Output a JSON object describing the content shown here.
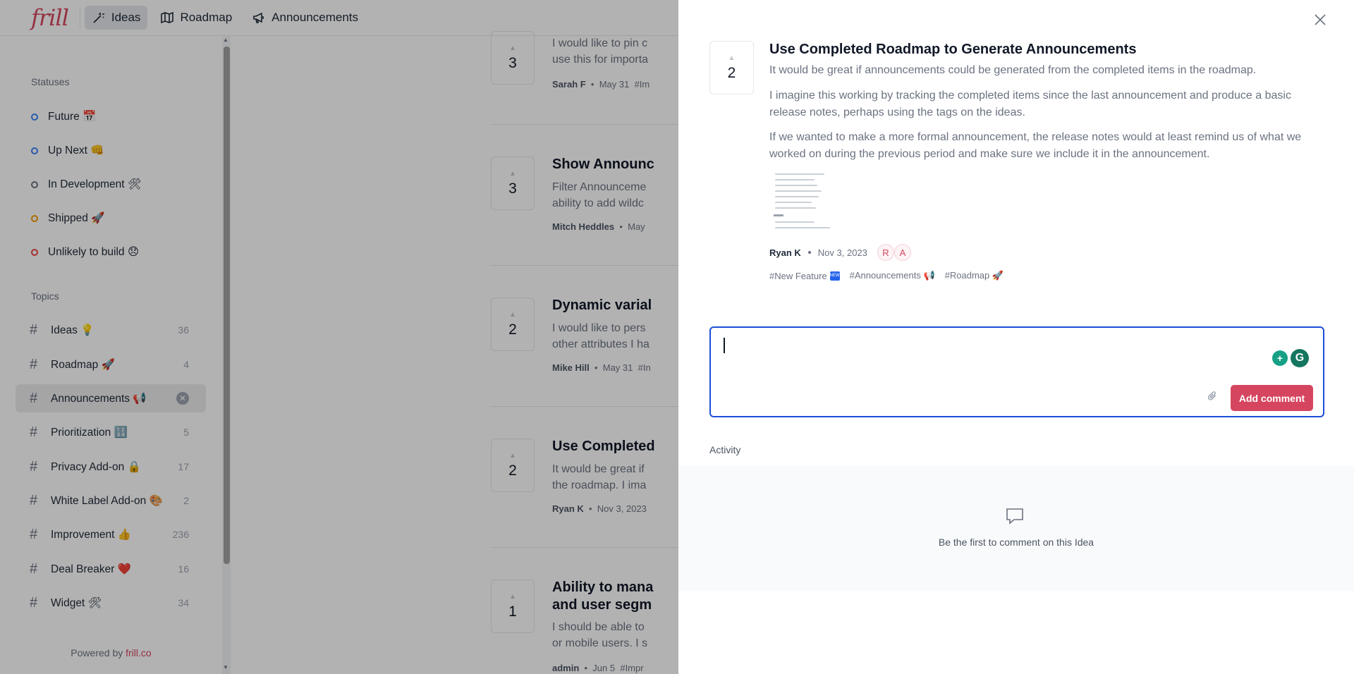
{
  "nav": {
    "logo": "frill",
    "items": [
      {
        "label": "Ideas",
        "icon": "magic-wand-icon",
        "active": true
      },
      {
        "label": "Roadmap",
        "icon": "map-icon",
        "active": false
      },
      {
        "label": "Announcements",
        "icon": "megaphone-icon",
        "active": false
      }
    ]
  },
  "sidebar": {
    "statuses_heading": "Statuses",
    "statuses": [
      {
        "label": "Future 📅",
        "color": "#3b82f6"
      },
      {
        "label": "Up Next 👊",
        "color": "#3b82f6"
      },
      {
        "label": "In Development 🛠",
        "color": "#6b7280"
      },
      {
        "label": "Shipped 🚀",
        "color": "#f59e0b"
      },
      {
        "label": "Unlikely to build 😞",
        "color": "#ef4444"
      }
    ],
    "topics_heading": "Topics",
    "topics": [
      {
        "label": "Ideas 💡",
        "count": "36"
      },
      {
        "label": "Roadmap 🚀",
        "count": "4"
      },
      {
        "label": "Announcements 📢",
        "count": "",
        "active": true
      },
      {
        "label": "Prioritization 🔢",
        "count": "5"
      },
      {
        "label": "Privacy Add-on 🔒",
        "count": "17"
      },
      {
        "label": "White Label Add-on 🎨",
        "count": "2"
      },
      {
        "label": "Improvement 👍",
        "count": "236"
      },
      {
        "label": "Deal Breaker ❤️",
        "count": "16"
      },
      {
        "label": "Widget 🛠",
        "count": "34"
      }
    ],
    "powered_prefix": "Powered by ",
    "powered_link": "frill.co"
  },
  "feed": [
    {
      "votes": "3",
      "title": "",
      "desc1": "I would like to pin c",
      "desc2": "use this for importa",
      "author": "Sarah F",
      "date": "May 31",
      "tag": "#Im"
    },
    {
      "votes": "3",
      "title": "Show Announc",
      "desc1": "Filter Announceme",
      "desc2": "ability to add wildc",
      "author": "Mitch Heddles",
      "date": "May",
      "tag": ""
    },
    {
      "votes": "2",
      "title": "Dynamic varial",
      "desc1": "I would like to pers",
      "desc2": "other attributes I ha",
      "author": "Mike Hill",
      "date": "May 31",
      "tag": "#In"
    },
    {
      "votes": "2",
      "title": "Use Completed",
      "desc1": "It would be great if",
      "desc2": "the roadmap. I ima",
      "author": "Ryan K",
      "date": "Nov 3, 2023",
      "tag": ""
    },
    {
      "votes": "1",
      "title": "Ability to mana",
      "title2": "and user segm",
      "desc1": "I should be able to",
      "desc2": "or mobile users. I s",
      "author": "admin",
      "date": "Jun 5",
      "tag": "#Impr"
    }
  ],
  "detail": {
    "votes": "2",
    "title": "Use Completed Roadmap to Generate Announcements",
    "paragraphs": [
      "It would be great if announcements could be generated from the completed items in the roadmap.",
      "I imagine this working by tracking the completed items since the last announcement and produce a basic release notes, perhaps using the tags on the ideas.",
      "If we wanted to make a more formal announcement, the release notes would at least remind us of what we worked on during the previous period and make sure we include it in the announcement."
    ],
    "author": "Ryan K",
    "date": "Nov 3, 2023",
    "avatars": [
      "R",
      "A"
    ],
    "tags": [
      {
        "label": "#New Feature",
        "emoji": "new"
      },
      {
        "label": "#Announcements 📢",
        "emoji": ""
      },
      {
        "label": "#Roadmap 🚀",
        "emoji": ""
      }
    ],
    "comment_value": "",
    "add_comment_label": "Add comment",
    "activity_label": "Activity",
    "empty_comments": "Be the first to comment on this Idea"
  },
  "colors": {
    "brand": "#d6455f",
    "focus": "#1d4ed8"
  }
}
